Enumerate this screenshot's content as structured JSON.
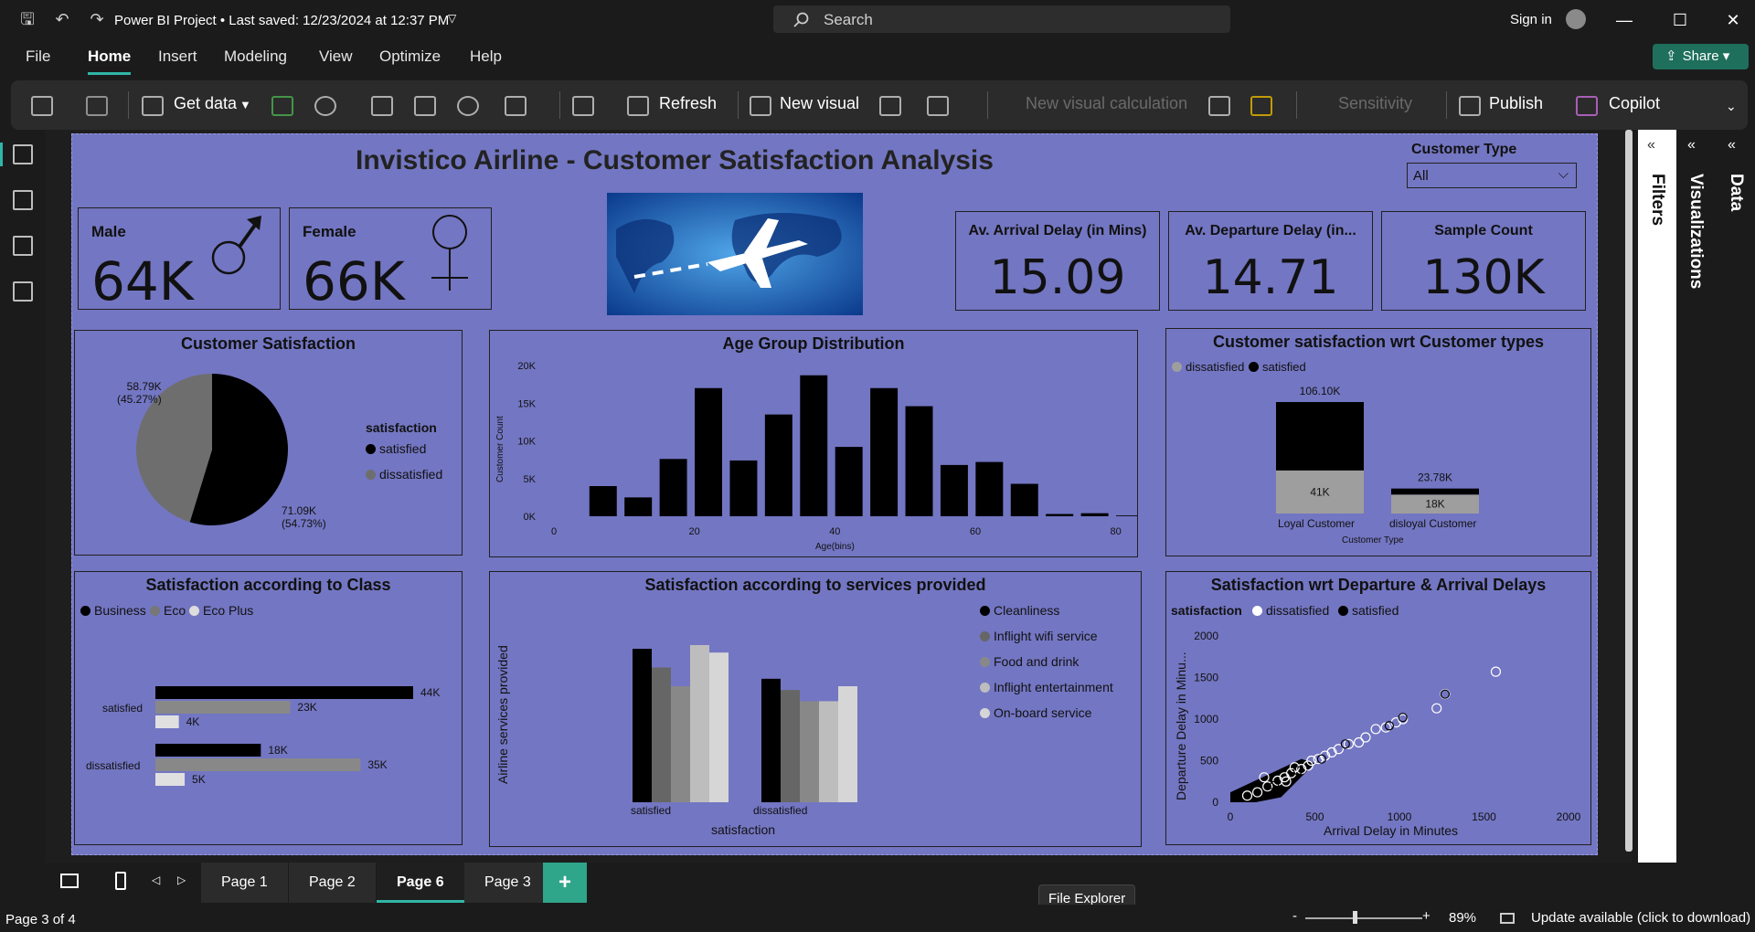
{
  "titlebar": {
    "doc_title": "Power BI Project • Last saved: 12/23/2024 at 12:37 PM",
    "search_placeholder": "Search",
    "signin": "Sign in"
  },
  "menu": {
    "file": "File",
    "home": "Home",
    "insert": "Insert",
    "modeling": "Modeling",
    "view": "View",
    "optimize": "Optimize",
    "help": "Help",
    "share": "Share"
  },
  "ribbon": {
    "get_data": "Get data",
    "refresh": "Refresh",
    "new_visual": "New visual",
    "new_visual_calc": "New visual calculation",
    "sensitivity": "Sensitivity",
    "publish": "Publish",
    "copilot": "Copilot"
  },
  "report": {
    "title": "Invistico Airline - Customer Satisfaction Analysis",
    "slicer": {
      "label": "Customer Type",
      "value": "All"
    },
    "male": {
      "label": "Male",
      "value": "64K"
    },
    "female": {
      "label": "Female",
      "value": "66K"
    },
    "cards": [
      {
        "label": "Av. Arrival Delay (in Mins)",
        "value": "15.09"
      },
      {
        "label": "Av. Departure Delay (in...",
        "value": "14.71"
      },
      {
        "label": "Sample Count",
        "value": "130K"
      }
    ],
    "pie": {
      "title": "Customer Satisfaction",
      "legend_title": "satisfaction",
      "legend": [
        "satisfied",
        "dissatisfied"
      ],
      "label_dis": "58.79K",
      "label_dis_pct": "(45.27%)",
      "label_sat": "71.09K",
      "label_sat_pct": "(54.73%)"
    },
    "age": {
      "title": "Age Group Distribution",
      "ylabel": "Customer Count",
      "xlabel": "Age(bins)",
      "yticks": [
        "20K",
        "15K",
        "10K",
        "5K",
        "0K"
      ],
      "xticks": [
        "0",
        "20",
        "40",
        "60",
        "80"
      ]
    },
    "ctype": {
      "title": "Customer satisfaction wrt Customer types",
      "legend": [
        "dissatisfied",
        "satisfied"
      ],
      "xlabel": "Customer Type",
      "loyal": "Loyal Customer",
      "disloyal": "disloyal Customer",
      "loyal_total": "106.10K",
      "loyal_dis": "41K",
      "disloyal_total": "23.78K",
      "disloyal_dis": "18K"
    },
    "class": {
      "title": "Satisfaction according to Class",
      "legend": [
        "Business",
        "Eco",
        "Eco Plus"
      ],
      "row1": "satisfied",
      "row2": "dissatisfied",
      "labels": [
        "44K",
        "23K",
        "4K",
        "18K",
        "35K",
        "5K"
      ]
    },
    "services": {
      "title": "Satisfaction according to services provided",
      "ylabel": "Airline services provided",
      "xlabel": "satisfaction",
      "groups": [
        "satisfied",
        "dissatisfied"
      ],
      "legend": [
        "Cleanliness",
        "Inflight wifi service",
        "Food and drink",
        "Inflight entertainment",
        "On-board service"
      ]
    },
    "delays": {
      "title": "Satisfaction wrt Departure & Arrival Delays",
      "legend_title": "satisfaction",
      "legend": [
        "dissatisfied",
        "satisfied"
      ],
      "ylabel": "Departure Delay in Minu...",
      "xlabel": "Arrival Delay in Minutes",
      "yticks": [
        "2000",
        "1500",
        "1000",
        "500",
        "0"
      ],
      "xticks": [
        "0",
        "500",
        "1000",
        "1500",
        "2000"
      ]
    }
  },
  "panes": {
    "filters": "Filters",
    "visualizations": "Visualizations",
    "data": "Data"
  },
  "tabs": {
    "page1": "Page 1",
    "page2": "Page 2",
    "page6": "Page 6",
    "page3": "Page 3",
    "add": "+"
  },
  "status": {
    "page": "Page 3 of 4",
    "zoom": "89%",
    "update": "Update available (click to download)",
    "tooltip": "File Explorer"
  },
  "chart_data": [
    {
      "type": "pie",
      "title": "Customer Satisfaction",
      "categories": [
        "satisfied",
        "dissatisfied"
      ],
      "values": [
        71090,
        58790
      ]
    },
    {
      "type": "bar",
      "title": "Age Group Distribution",
      "xlabel": "Age(bins)",
      "ylabel": "Customer Count",
      "x": [
        5,
        10,
        15,
        20,
        25,
        30,
        35,
        40,
        45,
        50,
        55,
        60,
        65,
        70,
        75,
        80
      ],
      "values": [
        4000,
        2500,
        7600,
        17000,
        7400,
        13500,
        18700,
        9200,
        17000,
        14600,
        6800,
        7200,
        4300,
        300,
        400,
        100
      ],
      "ylim": [
        0,
        20000
      ]
    },
    {
      "type": "bar",
      "title": "Customer satisfaction wrt Customer types",
      "categories": [
        "Loyal Customer",
        "disloyal Customer"
      ],
      "series": [
        {
          "name": "dissatisfied",
          "values": [
            41000,
            18000
          ]
        },
        {
          "name": "satisfied",
          "values": [
            65100,
            5780
          ]
        }
      ]
    },
    {
      "type": "bar",
      "title": "Satisfaction according to Class",
      "categories": [
        "satisfied",
        "dissatisfied"
      ],
      "series": [
        {
          "name": "Business",
          "values": [
            44000,
            18000
          ]
        },
        {
          "name": "Eco",
          "values": [
            23000,
            35000
          ]
        },
        {
          "name": "Eco Plus",
          "values": [
            4000,
            5000
          ]
        }
      ]
    },
    {
      "type": "bar",
      "title": "Satisfaction according to services provided",
      "categories": [
        "satisfied",
        "dissatisfied"
      ],
      "series": [
        {
          "name": "Cleanliness",
          "values": [
            4.1,
            3.3
          ]
        },
        {
          "name": "Inflight wifi service",
          "values": [
            3.6,
            3.0
          ]
        },
        {
          "name": "Food and drink",
          "values": [
            3.1,
            2.7
          ]
        },
        {
          "name": "Inflight entertainment",
          "values": [
            4.2,
            2.7
          ]
        },
        {
          "name": "On-board service",
          "values": [
            4.0,
            3.1
          ]
        }
      ]
    },
    {
      "type": "scatter",
      "title": "Satisfaction wrt Departure & Arrival Delays",
      "xlabel": "Arrival Delay in Minutes",
      "ylabel": "Departure Delay in Minu...",
      "xlim": [
        0,
        2000
      ],
      "ylim": [
        0,
        2000
      ]
    }
  ],
  "colors": {
    "report_bg": "#7376c2",
    "accent": "#2fb6a6",
    "satisfied": "#000000",
    "dissatisfied": "#6e6e6e"
  }
}
